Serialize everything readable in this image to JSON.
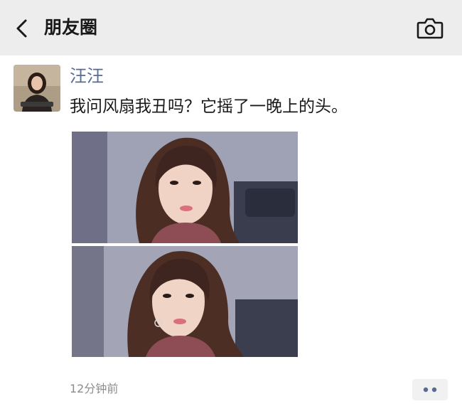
{
  "header": {
    "title": "朋友圈",
    "back_icon": "chevron-left-icon",
    "camera_icon": "camera-icon",
    "background": "#ededed"
  },
  "post": {
    "username": "汪汪",
    "username_color": "#576b95",
    "text": "我问风扇我丑吗？它摇了一晚上的头。",
    "images": [
      "selfie-photo",
      "selfie-photo"
    ],
    "timestamp": "12分钟前",
    "more_icon": "more-dots-icon"
  }
}
